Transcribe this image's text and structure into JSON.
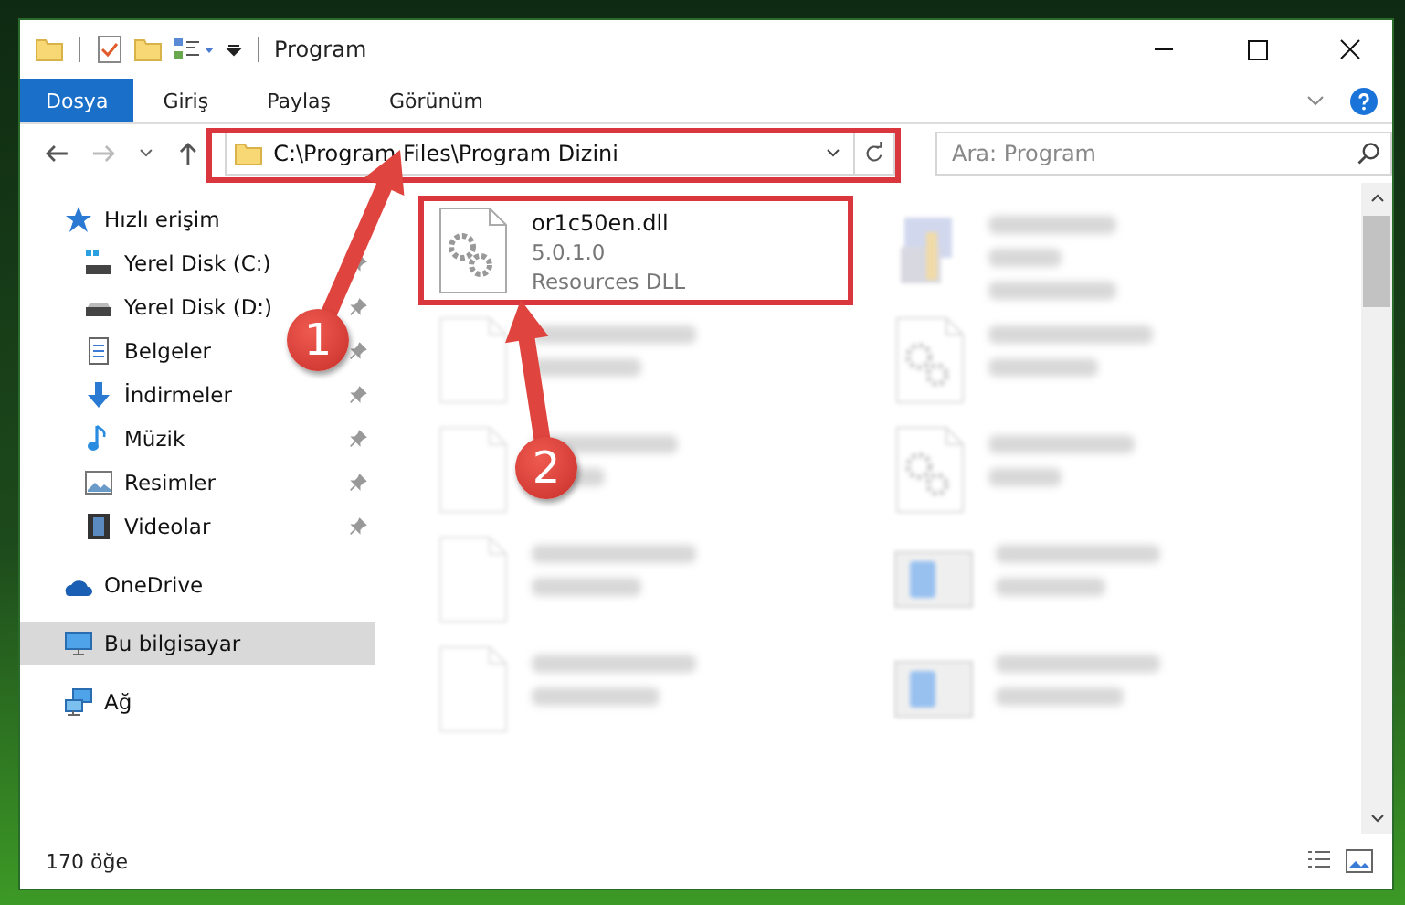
{
  "window": {
    "title": "Program"
  },
  "ribbon_tabs": [
    {
      "label": "Dosya",
      "selected": true
    },
    {
      "label": "Giriş",
      "selected": false
    },
    {
      "label": "Paylaş",
      "selected": false
    },
    {
      "label": "Görünüm",
      "selected": false
    }
  ],
  "address": {
    "path": "C:\\Program Files\\Program Dizini"
  },
  "search": {
    "placeholder": "Ara: Program"
  },
  "sidebar": {
    "items": [
      {
        "label": "Hızlı erişim",
        "kind": "star",
        "selected": false,
        "children": [
          {
            "label": "Yerel Disk (C:)",
            "kind": "system-drive",
            "pinned": true,
            "selected": false
          },
          {
            "label": "Yerel Disk (D:)",
            "kind": "drive",
            "pinned": true,
            "selected": false
          },
          {
            "label": "Belgeler",
            "kind": "document",
            "pinned": true,
            "selected": false
          },
          {
            "label": "İndirmeler",
            "kind": "download",
            "pinned": true,
            "selected": false
          },
          {
            "label": "Müzik",
            "kind": "music",
            "pinned": true,
            "selected": false
          },
          {
            "label": "Resimler",
            "kind": "pictures",
            "pinned": true,
            "selected": false
          },
          {
            "label": "Videolar",
            "kind": "video",
            "pinned": true,
            "selected": false
          }
        ]
      },
      {
        "label": "OneDrive",
        "kind": "cloud",
        "selected": false
      },
      {
        "label": "Bu bilgisayar",
        "kind": "computer",
        "selected": true
      },
      {
        "label": "Ağ",
        "kind": "network",
        "selected": false
      }
    ]
  },
  "files": [
    {
      "kind": "gear",
      "name": "or1c50en.dll",
      "version": "5.0.1.0",
      "type": "Resources DLL"
    },
    {
      "kind": "setup"
    },
    {
      "kind": "blank"
    },
    {
      "kind": "gear"
    },
    {
      "kind": "blank"
    },
    {
      "kind": "gear"
    },
    {
      "kind": "blank"
    },
    {
      "kind": "installer"
    },
    {
      "kind": "blank"
    },
    {
      "kind": "installer"
    }
  ],
  "status_bar": {
    "item_count": "170 öğe"
  },
  "annotations": [
    {
      "number": "1"
    },
    {
      "number": "2"
    }
  ]
}
